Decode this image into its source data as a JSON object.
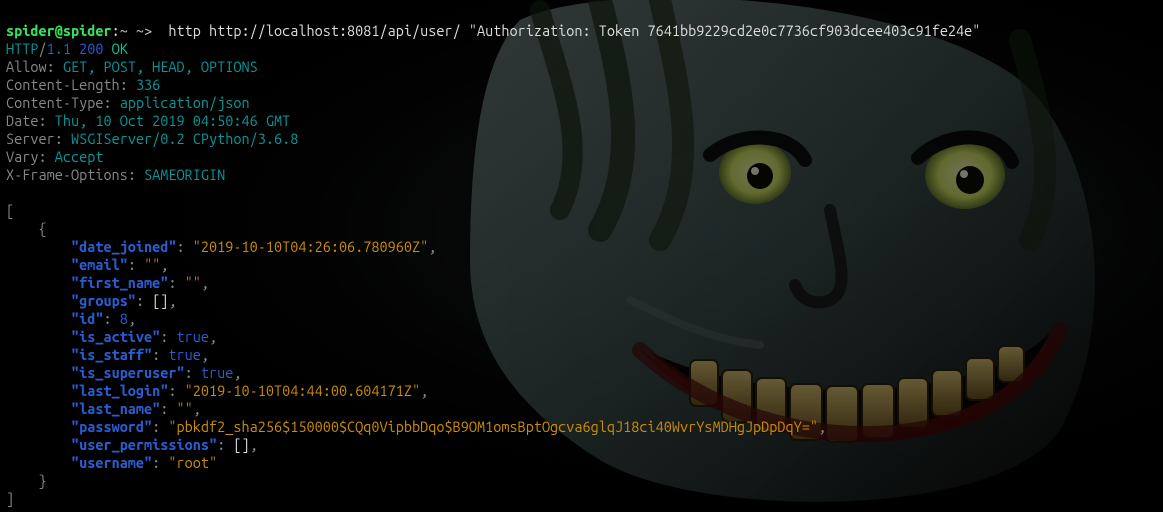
{
  "prompt": {
    "user": "spider@spider",
    "sep": ":",
    "path": "~ ~>  ",
    "command": "http http://localhost:8081/api/user/ \"Authorization: Token 7641bb9229cd2e0c7736cf903dcee403c91fe24e\""
  },
  "status": {
    "proto": "HTTP",
    "slash": "/",
    "ver": "1.1",
    "code": "200",
    "text": "OK"
  },
  "headers": {
    "allow_key": "Allow",
    "allow_val": "GET, POST, HEAD, OPTIONS",
    "clen_key": "Content-Length",
    "clen_val": "336",
    "ctype_key": "Content-Type",
    "ctype_val": "application/json",
    "date_key": "Date",
    "date_val": "Thu, 10 Oct 2019 04:50:46 GMT",
    "server_key": "Server",
    "server_val": "WSGIServer/0.2 CPython/3.6.8",
    "vary_key": "Vary",
    "vary_val": "Accept",
    "xframe_key": "X-Frame-Options",
    "xframe_val": "SAMEORIGIN"
  },
  "json": {
    "open_arr": "[",
    "open_obj": "{",
    "date_joined_k": "\"date_joined\"",
    "date_joined_v": "\"2019-10-10T04:26:06.780960Z\"",
    "email_k": "\"email\"",
    "email_v": "\"\"",
    "first_name_k": "\"first_name\"",
    "first_name_v": "\"\"",
    "groups_k": "\"groups\"",
    "groups_v": "[]",
    "id_k": "\"id\"",
    "id_v": "8",
    "is_active_k": "\"is_active\"",
    "is_active_v": "true",
    "is_staff_k": "\"is_staff\"",
    "is_staff_v": "true",
    "is_superuser_k": "\"is_superuser\"",
    "is_superuser_v": "true",
    "last_login_k": "\"last_login\"",
    "last_login_v": "\"2019-10-10T04:44:00.604171Z\"",
    "last_name_k": "\"last_name\"",
    "last_name_v": "\"\"",
    "password_k": "\"password\"",
    "password_v": "\"pbkdf2_sha256$150000$CQq0VipbbDqo$B9OM1omsBptOgcva6glqJ18ci40WvrYsMDHgJpDpDqY=\"",
    "user_perm_k": "\"user_permissions\"",
    "user_perm_v": "[]",
    "username_k": "\"username\"",
    "username_v": "\"root\"",
    "close_obj": "}",
    "close_arr": "]",
    "colon": ": ",
    "comma": ","
  }
}
